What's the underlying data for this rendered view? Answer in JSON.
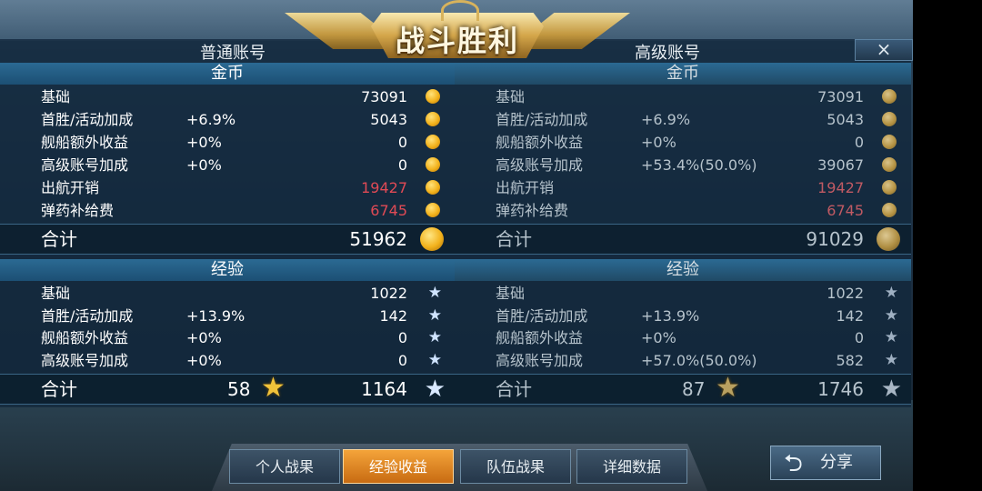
{
  "banner": {
    "title": "战斗胜利"
  },
  "close": {
    "symbol": "×"
  },
  "left": {
    "account_title": "普通账号",
    "gold": {
      "header": "金币",
      "rows": [
        {
          "label": "基础",
          "pct": "",
          "value": "73091",
          "negative": false
        },
        {
          "label": "首胜/活动加成",
          "pct": "+6.9%",
          "value": "5043",
          "negative": false
        },
        {
          "label": "舰船额外收益",
          "pct": "+0%",
          "value": "0",
          "negative": false
        },
        {
          "label": "高级账号加成",
          "pct": "+0%",
          "value": "0",
          "negative": false
        },
        {
          "label": "出航开销",
          "pct": "",
          "value": "19427",
          "negative": true
        },
        {
          "label": "弹药补给费",
          "pct": "",
          "value": "6745",
          "negative": true
        }
      ],
      "total_label": "合计",
      "total_value": "51962"
    },
    "exp": {
      "header": "经验",
      "rows": [
        {
          "label": "基础",
          "pct": "",
          "value": "1022"
        },
        {
          "label": "首胜/活动加成",
          "pct": "+13.9%",
          "value": "142"
        },
        {
          "label": "舰船额外收益",
          "pct": "+0%",
          "value": "0"
        },
        {
          "label": "高级账号加成",
          "pct": "+0%",
          "value": "0"
        }
      ],
      "total_label": "合计",
      "total_level": "58",
      "total_value": "1164"
    }
  },
  "right": {
    "account_title": "高级账号",
    "gold": {
      "header": "金币",
      "rows": [
        {
          "label": "基础",
          "pct": "",
          "value": "73091",
          "negative": false
        },
        {
          "label": "首胜/活动加成",
          "pct": "+6.9%",
          "value": "5043",
          "negative": false
        },
        {
          "label": "舰船额外收益",
          "pct": "+0%",
          "value": "0",
          "negative": false
        },
        {
          "label": "高级账号加成",
          "pct": "+53.4%(50.0%)",
          "value": "39067",
          "negative": false
        },
        {
          "label": "出航开销",
          "pct": "",
          "value": "19427",
          "negative": true
        },
        {
          "label": "弹药补给费",
          "pct": "",
          "value": "6745",
          "negative": true
        }
      ],
      "total_label": "合计",
      "total_value": "91029"
    },
    "exp": {
      "header": "经验",
      "rows": [
        {
          "label": "基础",
          "pct": "",
          "value": "1022"
        },
        {
          "label": "首胜/活动加成",
          "pct": "+13.9%",
          "value": "142"
        },
        {
          "label": "舰船额外收益",
          "pct": "+0%",
          "value": "0"
        },
        {
          "label": "高级账号加成",
          "pct": "+57.0%(50.0%)",
          "value": "582"
        }
      ],
      "total_label": "合计",
      "total_level": "87",
      "total_value": "1746"
    }
  },
  "tabs": [
    {
      "label": "个人战果",
      "active": false
    },
    {
      "label": "经验收益",
      "active": true
    },
    {
      "label": "队伍战果",
      "active": false
    },
    {
      "label": "详细数据",
      "active": false
    }
  ],
  "share": {
    "label": "分享",
    "icon": "back-arrow-icon"
  },
  "icons": {
    "coin": "gold-coin-icon",
    "star": "star-icon"
  },
  "colors": {
    "negative": "#e04a55",
    "tab_active": "#f4a43a",
    "section_bar": "#2b6a93"
  }
}
